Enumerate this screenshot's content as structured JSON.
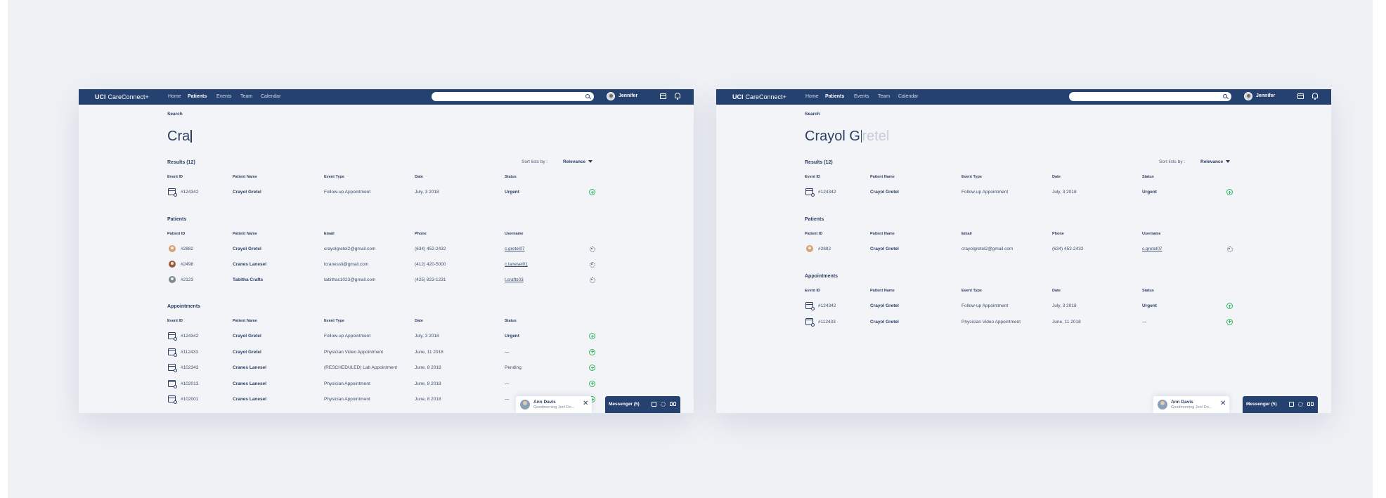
{
  "app": {
    "brand_bold": "UCI",
    "brand_rest": "CareConnect+",
    "nav": [
      "Home",
      "Patients",
      "Events",
      "Team",
      "Calendar"
    ],
    "active_nav": "Patients",
    "user_name": "Jennifer"
  },
  "left": {
    "search_label": "Search",
    "query": "Cra",
    "query_ghost": "",
    "results_label": "Results (12)",
    "sort_label": "Sort lists by :",
    "sort_value": "Relevance",
    "events": {
      "headers": [
        "Event ID",
        "Patient Name",
        "Event Type",
        "Date",
        "Status"
      ],
      "rows": [
        {
          "id": "#124342",
          "name": "Crayol Gretel",
          "type": "Follow-up Appointment",
          "date": "July, 3 2018",
          "status": "Urgent",
          "status_bold": true
        }
      ]
    },
    "patients": {
      "title": "Patients",
      "headers": [
        "Patient ID",
        "Patient Name",
        "Email",
        "Phone",
        "Username"
      ],
      "rows": [
        {
          "id": "#2882",
          "name": "Crayol Gretel",
          "email": "crayolgretel2@gmail.com",
          "phone": "(634) 452-2432",
          "username": "c.gretel07",
          "avatar_color": "#d4a373"
        },
        {
          "id": "#2498",
          "name": "Cranes Lanesel",
          "email": "lcranessli@gmail.com",
          "phone": "(412) 420-5000",
          "username": "c.lanesel01",
          "avatar_color": "#9c5b3f"
        },
        {
          "id": "#2123",
          "name": "Tabitha Crafts",
          "email": "tabithac1023@gmail.com",
          "phone": "(425) 823-1231",
          "username": "t.crafts03",
          "avatar_color": "#7b8a8f"
        }
      ]
    },
    "appointments": {
      "title": "Appointments",
      "headers": [
        "Event ID",
        "Patient Name",
        "Event Type",
        "Date",
        "Status"
      ],
      "rows": [
        {
          "id": "#124342",
          "name": "Crayol Gretel",
          "type": "Follow-up Appointment",
          "date": "July, 3 2018",
          "status": "Urgent",
          "status_bold": true
        },
        {
          "id": "#112433",
          "name": "Crayol Gretel",
          "type": "Physician Video Appointment",
          "date": "June, 11 2018",
          "status": "—",
          "status_bold": false
        },
        {
          "id": "#102343",
          "name": "Cranes Lanesel",
          "type": "(RESCHEDULED) Lab Appointment",
          "date": "June, 8 2018",
          "status": "Pending",
          "status_bold": false
        },
        {
          "id": "#102013",
          "name": "Cranes Lanesel",
          "type": "Physician Appointment",
          "date": "June, 8 2018",
          "status": "—",
          "status_bold": false
        },
        {
          "id": "#102001",
          "name": "Cranes Lanesel",
          "type": "Physician Appointment",
          "date": "June, 8 2018",
          "status": "—",
          "status_bold": false
        }
      ]
    }
  },
  "right": {
    "search_label": "Search",
    "query": "Crayol G",
    "query_ghost": "retel",
    "results_label": "Results (12)",
    "sort_label": "Sort lists by :",
    "sort_value": "Relevance",
    "events": {
      "headers": [
        "Event ID",
        "Patient Name",
        "Event Type",
        "Date",
        "Status"
      ],
      "rows": [
        {
          "id": "#124342",
          "name": "Crayol Gretel",
          "type": "Follow-up Appointment",
          "date": "July, 3 2018",
          "status": "Urgent",
          "status_bold": true
        }
      ]
    },
    "patients": {
      "title": "Patients",
      "headers": [
        "Patient ID",
        "Patient Name",
        "Email",
        "Phone",
        "Username"
      ],
      "rows": [
        {
          "id": "#2882",
          "name": "Crayol Gretel",
          "email": "crayolgretel2@gmail.com",
          "phone": "(634) 452-2432",
          "username": "c.gretel07",
          "avatar_color": "#d4a373"
        }
      ]
    },
    "appointments": {
      "title": "Appointments",
      "headers": [
        "Event ID",
        "Patient Name",
        "Event Type",
        "Date",
        "Status"
      ],
      "rows": [
        {
          "id": "#124342",
          "name": "Crayol Gretel",
          "type": "Follow-up Appointment",
          "date": "July, 3 2018",
          "status": "Urgent",
          "status_bold": true
        },
        {
          "id": "#112433",
          "name": "Crayol Gretel",
          "type": "Physician Video Appointment",
          "date": "June, 11 2018",
          "status": "—",
          "status_bold": false
        }
      ]
    }
  },
  "chat": {
    "name": "Ann Davis",
    "preview": "Goodmorning Jen! Do...",
    "close_glyph": "✕"
  },
  "messenger": {
    "label": "Messenger (5)"
  },
  "colors": {
    "navy": "#25416f",
    "page": "#f3f4f8",
    "accent_green": "#31b85f"
  }
}
